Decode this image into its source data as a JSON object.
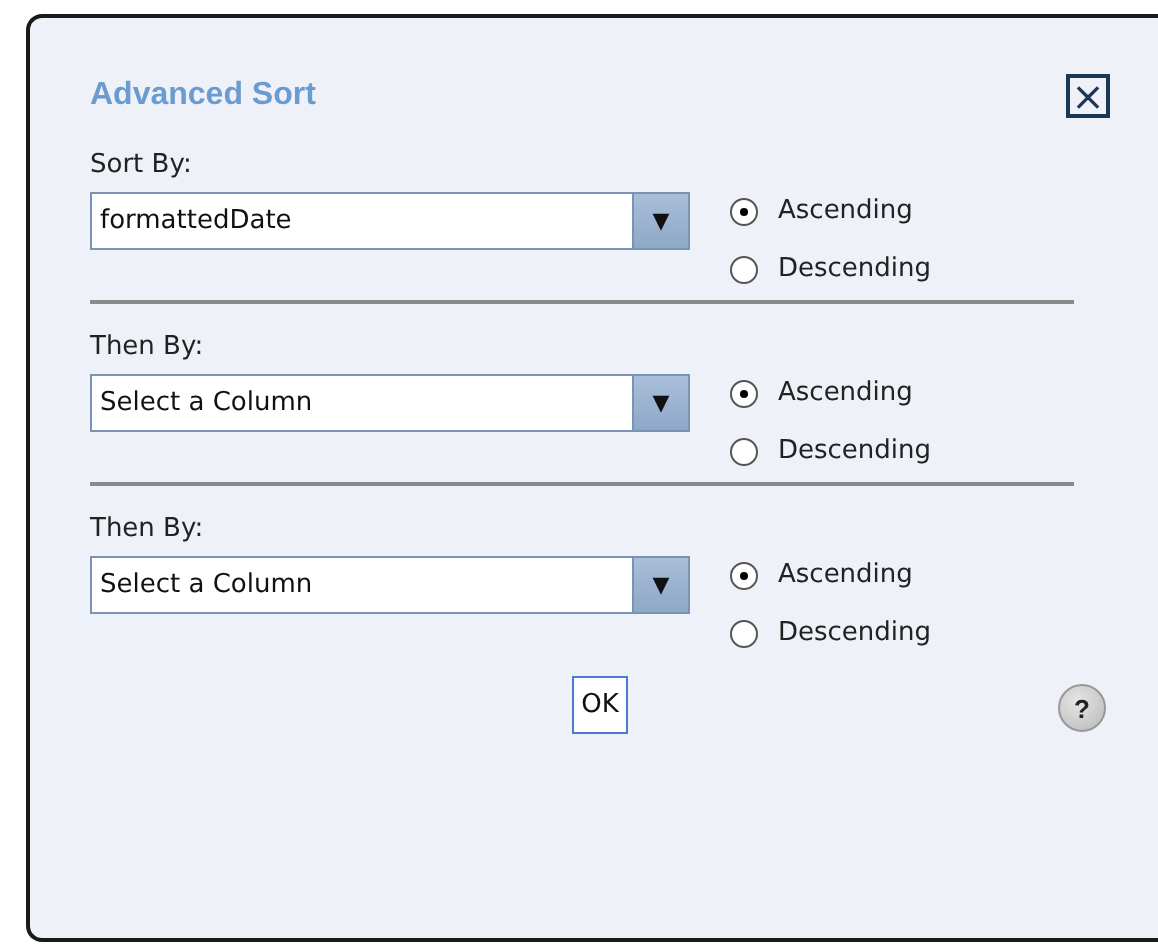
{
  "dialog": {
    "title": "Advanced Sort",
    "close_label": "×"
  },
  "sort_levels": [
    {
      "label": "Sort By:",
      "value": "formattedDate",
      "arrow": "▼",
      "options": [
        {
          "label": "Ascending",
          "selected": true
        },
        {
          "label": "Descending",
          "selected": false
        }
      ]
    },
    {
      "label": "Then By:",
      "value": "Select a Column",
      "arrow": "▼",
      "options": [
        {
          "label": "Ascending",
          "selected": true
        },
        {
          "label": "Descending",
          "selected": false
        }
      ]
    },
    {
      "label": "Then By:",
      "value": "Select a Column",
      "arrow": "▼",
      "options": [
        {
          "label": "Ascending",
          "selected": true
        },
        {
          "label": "Descending",
          "selected": false
        }
      ]
    }
  ],
  "buttons": {
    "ok": "OK",
    "help": "?"
  }
}
